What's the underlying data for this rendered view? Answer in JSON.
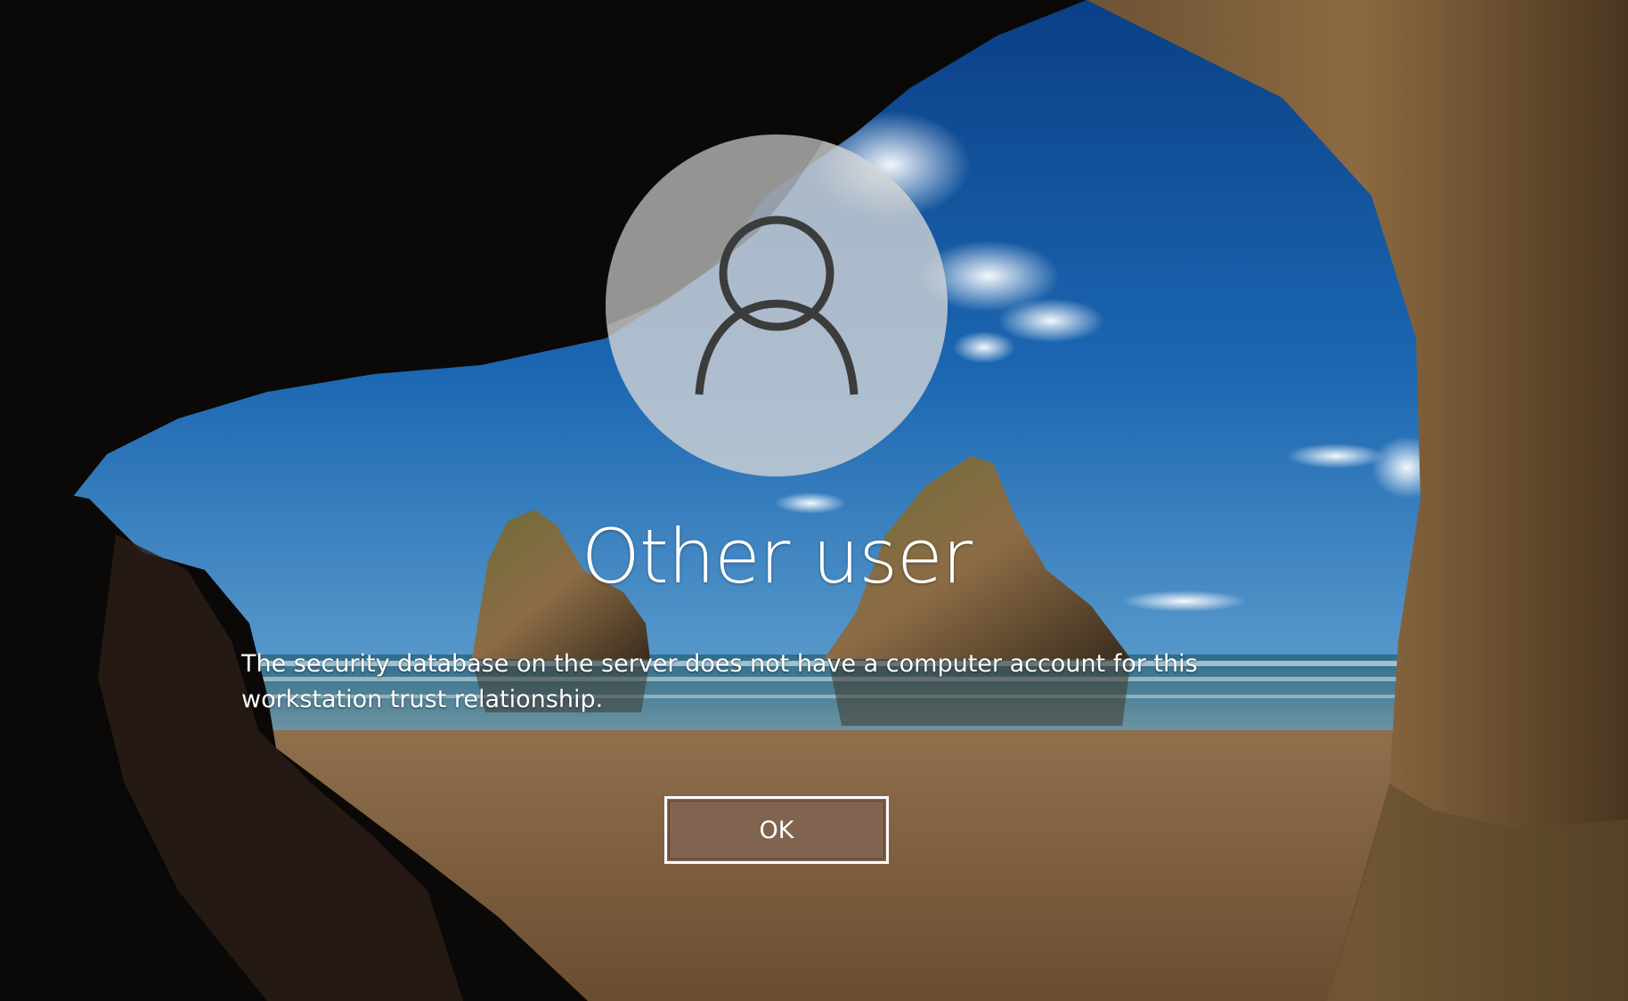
{
  "login": {
    "user_name": "Other user",
    "message": "The security database on the server does not have a computer account for this workstation trust relationship.",
    "ok_label": "OK"
  },
  "icons": {
    "avatar": "person-icon"
  },
  "colors": {
    "button_fill": "#806450",
    "button_border": "#ffffff",
    "text": "#ffffff",
    "avatar_fill": "#d6d6d6",
    "avatar_glyph": "#3c3c3c"
  }
}
